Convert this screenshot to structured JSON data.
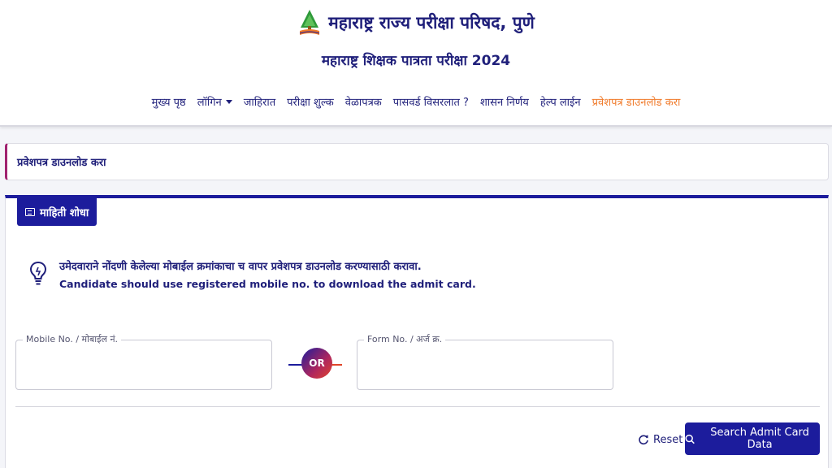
{
  "header": {
    "org_title": "महाराष्ट्र राज्य परीक्षा परिषद, पुणे",
    "exam_title": "महाराष्ट्र शिक्षक पात्रता परीक्षा 2024"
  },
  "nav": {
    "items": [
      {
        "label": "मुख्य पृष्ठ"
      },
      {
        "label": "लॉगिन"
      },
      {
        "label": "जाहिरात"
      },
      {
        "label": "परीक्षा शुल्क"
      },
      {
        "label": "वेळापत्रक"
      },
      {
        "label": "पासवर्ड विसरलात ?"
      },
      {
        "label": "शासन निर्णय"
      },
      {
        "label": "हेल्प लाईन"
      },
      {
        "label": "प्रवेशपत्र डाउनलोड करा"
      }
    ]
  },
  "breadcrumb": {
    "title": "प्रवेशपत्र डाउनलोड करा"
  },
  "panel": {
    "tab_label": "माहिती शोधा",
    "info_marathi": "उमेदवाराने नोंदणी केलेल्या मोबाईल क्रमांकाचा च वापर प्रवेशपत्र डाउनलोड करण्यासाठी करावा.",
    "info_english": "Candidate should use registered mobile no. to download the admit card.",
    "mobile_label": "Mobile No. / मोबाईल नं.",
    "mobile_value": "",
    "or_label": "OR",
    "form_label": "Form No. / अर्ज क्र.",
    "form_value": "",
    "reset_label": "Reset",
    "search_label": "Search Admit Card Data"
  },
  "colors": {
    "primary": "#1c1c9c",
    "active_nav": "#f07a2a",
    "accent": "#a0226f"
  }
}
